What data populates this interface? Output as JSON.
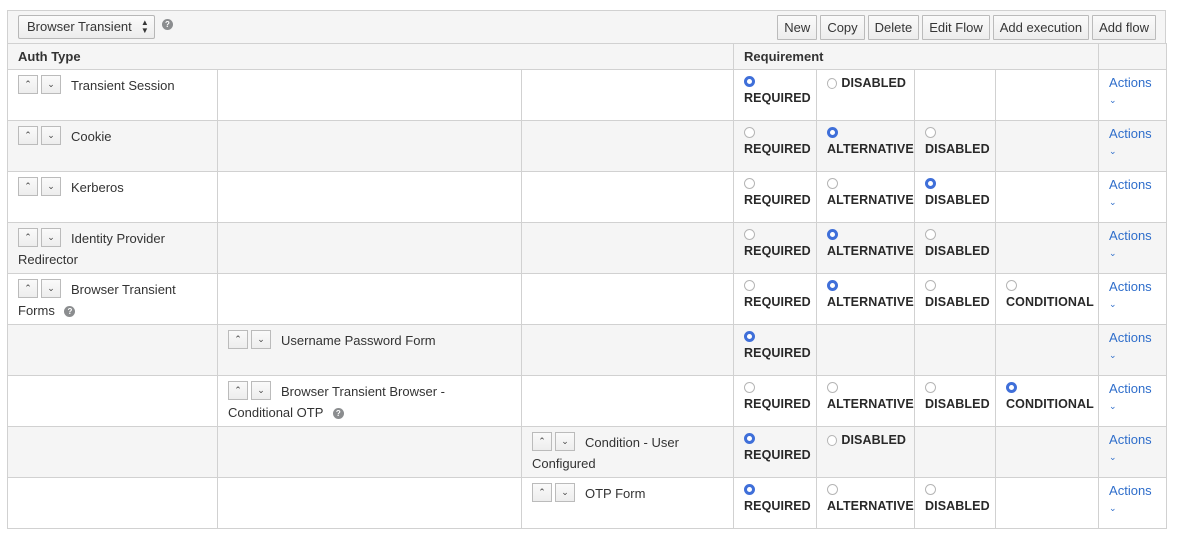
{
  "toolbar": {
    "flow_select_value": "Browser Transient",
    "help_icon": "?",
    "buttons": [
      "New",
      "Copy",
      "Delete",
      "Edit Flow",
      "Add execution",
      "Add flow"
    ]
  },
  "table": {
    "headers": {
      "auth_type": "Auth Type",
      "requirement": "Requirement"
    },
    "actions_label": "Actions",
    "rows": [
      {
        "name": "Transient Session",
        "level": 0,
        "help": false,
        "options": [
          {
            "label": "REQUIRED",
            "selected": true
          },
          {
            "label": "DISABLED",
            "selected": false,
            "inline": true
          }
        ]
      },
      {
        "name": "Cookie",
        "level": 0,
        "help": false,
        "options": [
          {
            "label": "REQUIRED",
            "selected": false
          },
          {
            "label": "ALTERNATIVE",
            "selected": true
          },
          {
            "label": "DISABLED",
            "selected": false
          }
        ]
      },
      {
        "name": "Kerberos",
        "level": 0,
        "help": false,
        "options": [
          {
            "label": "REQUIRED",
            "selected": false
          },
          {
            "label": "ALTERNATIVE",
            "selected": false
          },
          {
            "label": "DISABLED",
            "selected": true
          }
        ]
      },
      {
        "name": "Identity Provider Redirector",
        "level": 0,
        "help": false,
        "options": [
          {
            "label": "REQUIRED",
            "selected": false
          },
          {
            "label": "ALTERNATIVE",
            "selected": true
          },
          {
            "label": "DISABLED",
            "selected": false
          }
        ]
      },
      {
        "name": "Browser Transient Forms",
        "level": 0,
        "help": true,
        "options": [
          {
            "label": "REQUIRED",
            "selected": false
          },
          {
            "label": "ALTERNATIVE",
            "selected": true
          },
          {
            "label": "DISABLED",
            "selected": false
          },
          {
            "label": "CONDITIONAL",
            "selected": false
          }
        ]
      },
      {
        "name": "Username Password Form",
        "level": 1,
        "help": false,
        "options": [
          {
            "label": "REQUIRED",
            "selected": true
          }
        ]
      },
      {
        "name": "Browser Transient Browser - Conditional OTP",
        "level": 1,
        "help": true,
        "options": [
          {
            "label": "REQUIRED",
            "selected": false
          },
          {
            "label": "ALTERNATIVE",
            "selected": false
          },
          {
            "label": "DISABLED",
            "selected": false
          },
          {
            "label": "CONDITIONAL",
            "selected": true
          }
        ]
      },
      {
        "name": "Condition - User Configured",
        "level": 2,
        "help": false,
        "options": [
          {
            "label": "REQUIRED",
            "selected": true
          },
          {
            "label": "DISABLED",
            "selected": false,
            "inline": true
          }
        ]
      },
      {
        "name": "OTP Form",
        "level": 2,
        "help": false,
        "options": [
          {
            "label": "REQUIRED",
            "selected": true
          },
          {
            "label": "ALTERNATIVE",
            "selected": false
          },
          {
            "label": "DISABLED",
            "selected": false
          }
        ]
      }
    ]
  },
  "icons": {
    "move_up": "chevron-up-icon",
    "move_down": "chevron-down-icon",
    "actions_caret": "chevron-down-icon",
    "help": "question-circle-icon"
  },
  "colors": {
    "accent": "#3f6fd9",
    "link": "#2f6ecb",
    "alt_row": "#f5f5f5",
    "border": "#d1d1d1"
  }
}
